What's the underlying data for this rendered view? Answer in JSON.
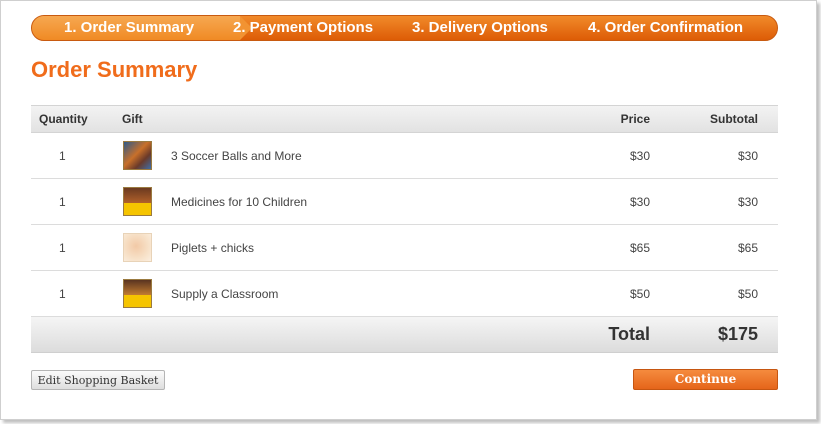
{
  "steps": [
    {
      "label": "1. Order Summary",
      "active": true
    },
    {
      "label": "2. Payment Options",
      "active": false
    },
    {
      "label": "3. Delivery Options",
      "active": false
    },
    {
      "label": "4. Order Confirmation",
      "active": false
    }
  ],
  "page_title": "Order Summary",
  "table": {
    "headers": {
      "quantity": "Quantity",
      "gift": "Gift",
      "price": "Price",
      "subtotal": "Subtotal"
    },
    "rows": [
      {
        "quantity": "1",
        "icon": "soccer-players-photo-icon",
        "name": "3 Soccer Balls and More",
        "price": "$30",
        "subtotal": "$30"
      },
      {
        "quantity": "1",
        "icon": "children-medicine-photo-icon",
        "name": "Medicines for 10 Children",
        "price": "$30",
        "subtotal": "$30"
      },
      {
        "quantity": "1",
        "icon": "piglet-photo-icon",
        "name": "Piglets + chicks",
        "price": "$65",
        "subtotal": "$65"
      },
      {
        "quantity": "1",
        "icon": "classroom-photo-icon",
        "name": "Supply a Classroom",
        "price": "$50",
        "subtotal": "$50"
      }
    ],
    "total_label": "Total",
    "total_value": "$175"
  },
  "buttons": {
    "edit_basket": "Edit Shopping Basket",
    "continue": "Continue"
  },
  "colors": {
    "accent": "#f06c1b",
    "step_bar": "#e56a12",
    "active_step": "#f29332"
  }
}
